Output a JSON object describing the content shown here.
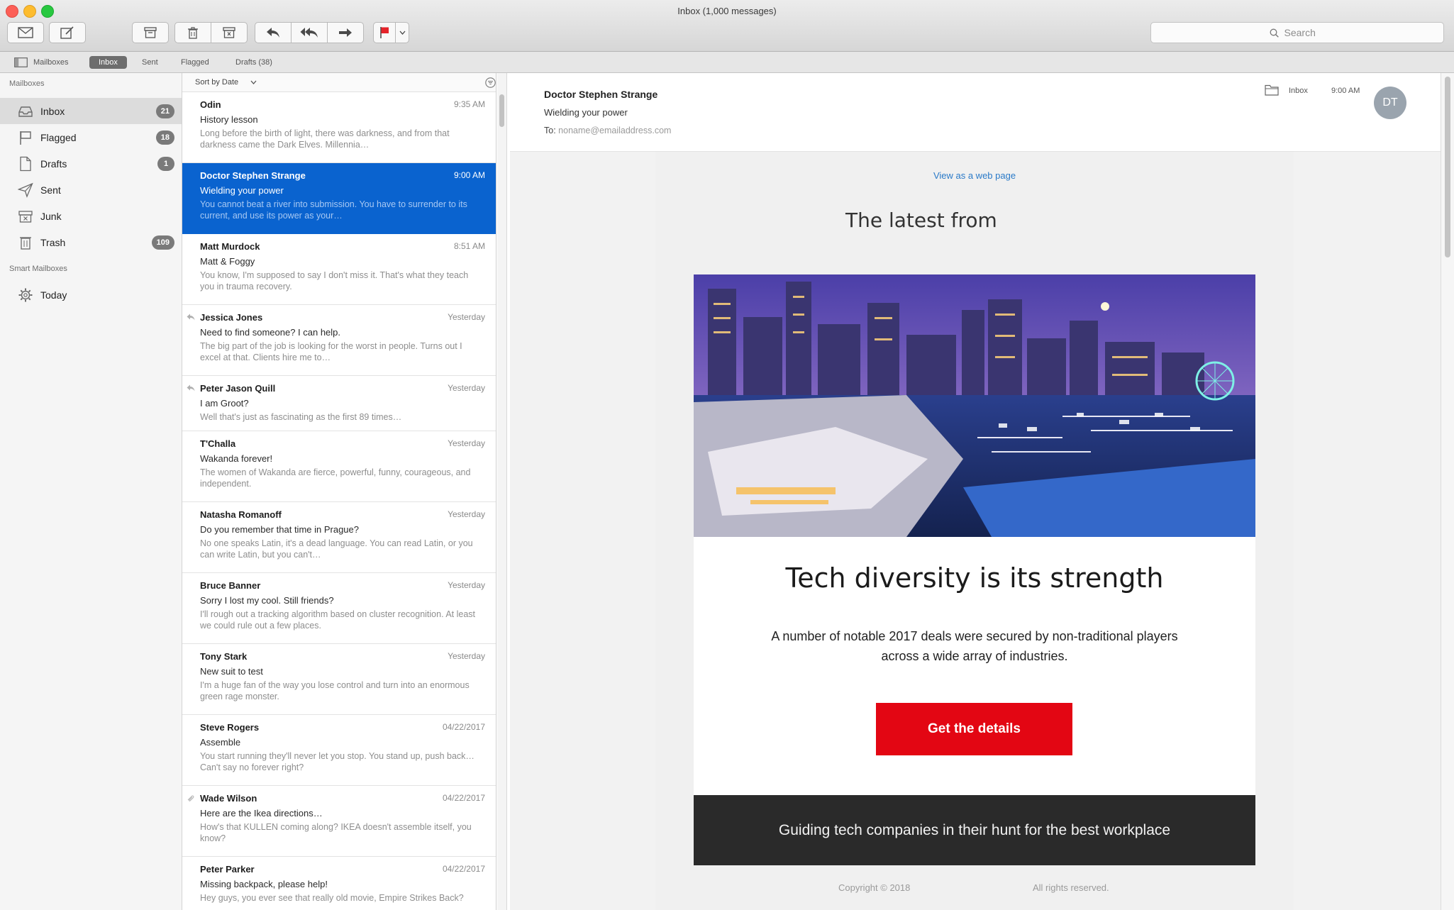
{
  "window": {
    "title": "Inbox (1,000 messages)"
  },
  "toolbar": {
    "search_placeholder": "Search",
    "buttons": [
      "get-mail",
      "compose",
      "archive",
      "delete",
      "junk",
      "reply",
      "reply-all",
      "forward",
      "flag"
    ]
  },
  "favorites": {
    "mailboxes": "Mailboxes",
    "inbox": "Inbox",
    "sent": "Sent",
    "flagged": "Flagged",
    "drafts": "Drafts (38)"
  },
  "sidebar": {
    "mailboxes_header": "Mailboxes",
    "smart_header": "Smart Mailboxes",
    "items": [
      {
        "label": "Inbox",
        "count": "21",
        "icon": "inbox-icon"
      },
      {
        "label": "Flagged",
        "count": "18",
        "icon": "flag-icon"
      },
      {
        "label": "Drafts",
        "count": "1",
        "icon": "document-icon"
      },
      {
        "label": "Sent",
        "count": "",
        "icon": "paper-plane-icon"
      },
      {
        "label": "Junk",
        "count": "",
        "icon": "junk-box-icon"
      },
      {
        "label": "Trash",
        "count": "109",
        "icon": "trash-icon"
      }
    ],
    "smart_items": [
      {
        "label": "Today",
        "icon": "gear-icon"
      }
    ]
  },
  "list": {
    "sort_label": "Sort by Date",
    "messages": [
      {
        "from": "Odin",
        "time": "9:35 AM",
        "subject": "History lesson",
        "preview": "Long before the birth of light, there was darkness, and from that darkness came the Dark Elves. Millennia…",
        "mark": ""
      },
      {
        "from": "Doctor Stephen Strange",
        "time": "9:00 AM",
        "subject": "Wielding your power",
        "preview": "You cannot beat a river into submission. You have to surrender to its current, and use its power as your…",
        "mark": ""
      },
      {
        "from": "Matt Murdock",
        "time": "8:51 AM",
        "subject": "Matt & Foggy",
        "preview": "You know, I'm supposed to say I don't miss it. That's what they teach you in trauma recovery.",
        "mark": ""
      },
      {
        "from": "Jessica Jones",
        "time": "Yesterday",
        "subject": "Need to find someone? I can help.",
        "preview": "The big part of the job is looking for the worst in people. Turns out I excel at that. Clients hire me to…",
        "mark": "replied"
      },
      {
        "from": "Peter Jason Quill",
        "time": "Yesterday",
        "subject": "I am Groot?",
        "preview": "Well that's just as fascinating as the first 89 times…",
        "mark": "replied"
      },
      {
        "from": "T'Challa",
        "time": "Yesterday",
        "subject": "Wakanda forever!",
        "preview": "The women of Wakanda are fierce, powerful, funny, courageous, and independent.",
        "mark": ""
      },
      {
        "from": "Natasha Romanoff",
        "time": "Yesterday",
        "subject": "Do you remember that time in Prague?",
        "preview": "No one speaks Latin, it's a dead language. You can read Latin, or you can write Latin, but you can't…",
        "mark": ""
      },
      {
        "from": "Bruce Banner",
        "time": "Yesterday",
        "subject": "Sorry I lost my cool. Still friends?",
        "preview": "I'll rough out a tracking algorithm based on cluster recognition. At least we could rule out a few places.",
        "mark": ""
      },
      {
        "from": "Tony Stark",
        "time": "Yesterday",
        "subject": "New suit to test",
        "preview": "I'm a huge fan of the way you lose control and turn into an enormous green rage monster.",
        "mark": ""
      },
      {
        "from": "Steve Rogers",
        "time": "04/22/2017",
        "subject": "Assemble",
        "preview": "You start running they'll never let you stop. You stand up, push back… Can't say no forever right?",
        "mark": ""
      },
      {
        "from": "Wade Wilson",
        "time": "04/22/2017",
        "subject": "Here are the Ikea directions…",
        "preview": "How's that KULLEN coming along? IKEA doesn't assemble itself, you know?",
        "mark": "attachment"
      },
      {
        "from": "Peter Parker",
        "time": "04/22/2017",
        "subject": "Missing backpack, please help!",
        "preview": "Hey guys, you ever see that really old movie, Empire Strikes Back?",
        "mark": ""
      }
    ]
  },
  "reader": {
    "from": "Doctor Stephen Strange",
    "subject": "Wielding your power",
    "to_label": "To:",
    "to_address": "noname@emailaddress.com",
    "mailbox": "Inbox",
    "time": "9:00 AM",
    "avatar_initials": "DT",
    "email": {
      "web_link": "View as a web page",
      "latest_from": "The latest from",
      "headline": "Tech diversity is its strength",
      "body": "A number of notable 2017 deals were secured by non-traditional players across a wide array of industries.",
      "cta": "Get the details",
      "banner": "Guiding tech companies in their hunt for the best workplace",
      "copyright": "Copyright © 2018",
      "rights": "All rights reserved."
    }
  },
  "colors": {
    "selection_blue": "#0a63cf",
    "cta_red": "#e30613",
    "badge_gray": "#7a7a7a",
    "link_blue": "#2a7ac8"
  }
}
